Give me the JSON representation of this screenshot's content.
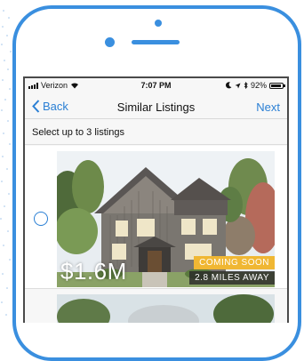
{
  "status_bar": {
    "carrier": "Verizon",
    "time": "7:07 PM",
    "battery": "92%",
    "battery_level": 0.92
  },
  "nav": {
    "back_label": "Back",
    "title": "Similar Listings",
    "next_label": "Next"
  },
  "instruction": "Select up to 3 listings",
  "listings": [
    {
      "price": "$1.6M",
      "status": "COMING SOON",
      "distance": "2.8 MILES AWAY",
      "selected": false
    }
  ],
  "colors": {
    "device_frame": "#3a8fdf",
    "accent": "#2a7fd4",
    "coming_soon_badge": "#f0b733"
  }
}
